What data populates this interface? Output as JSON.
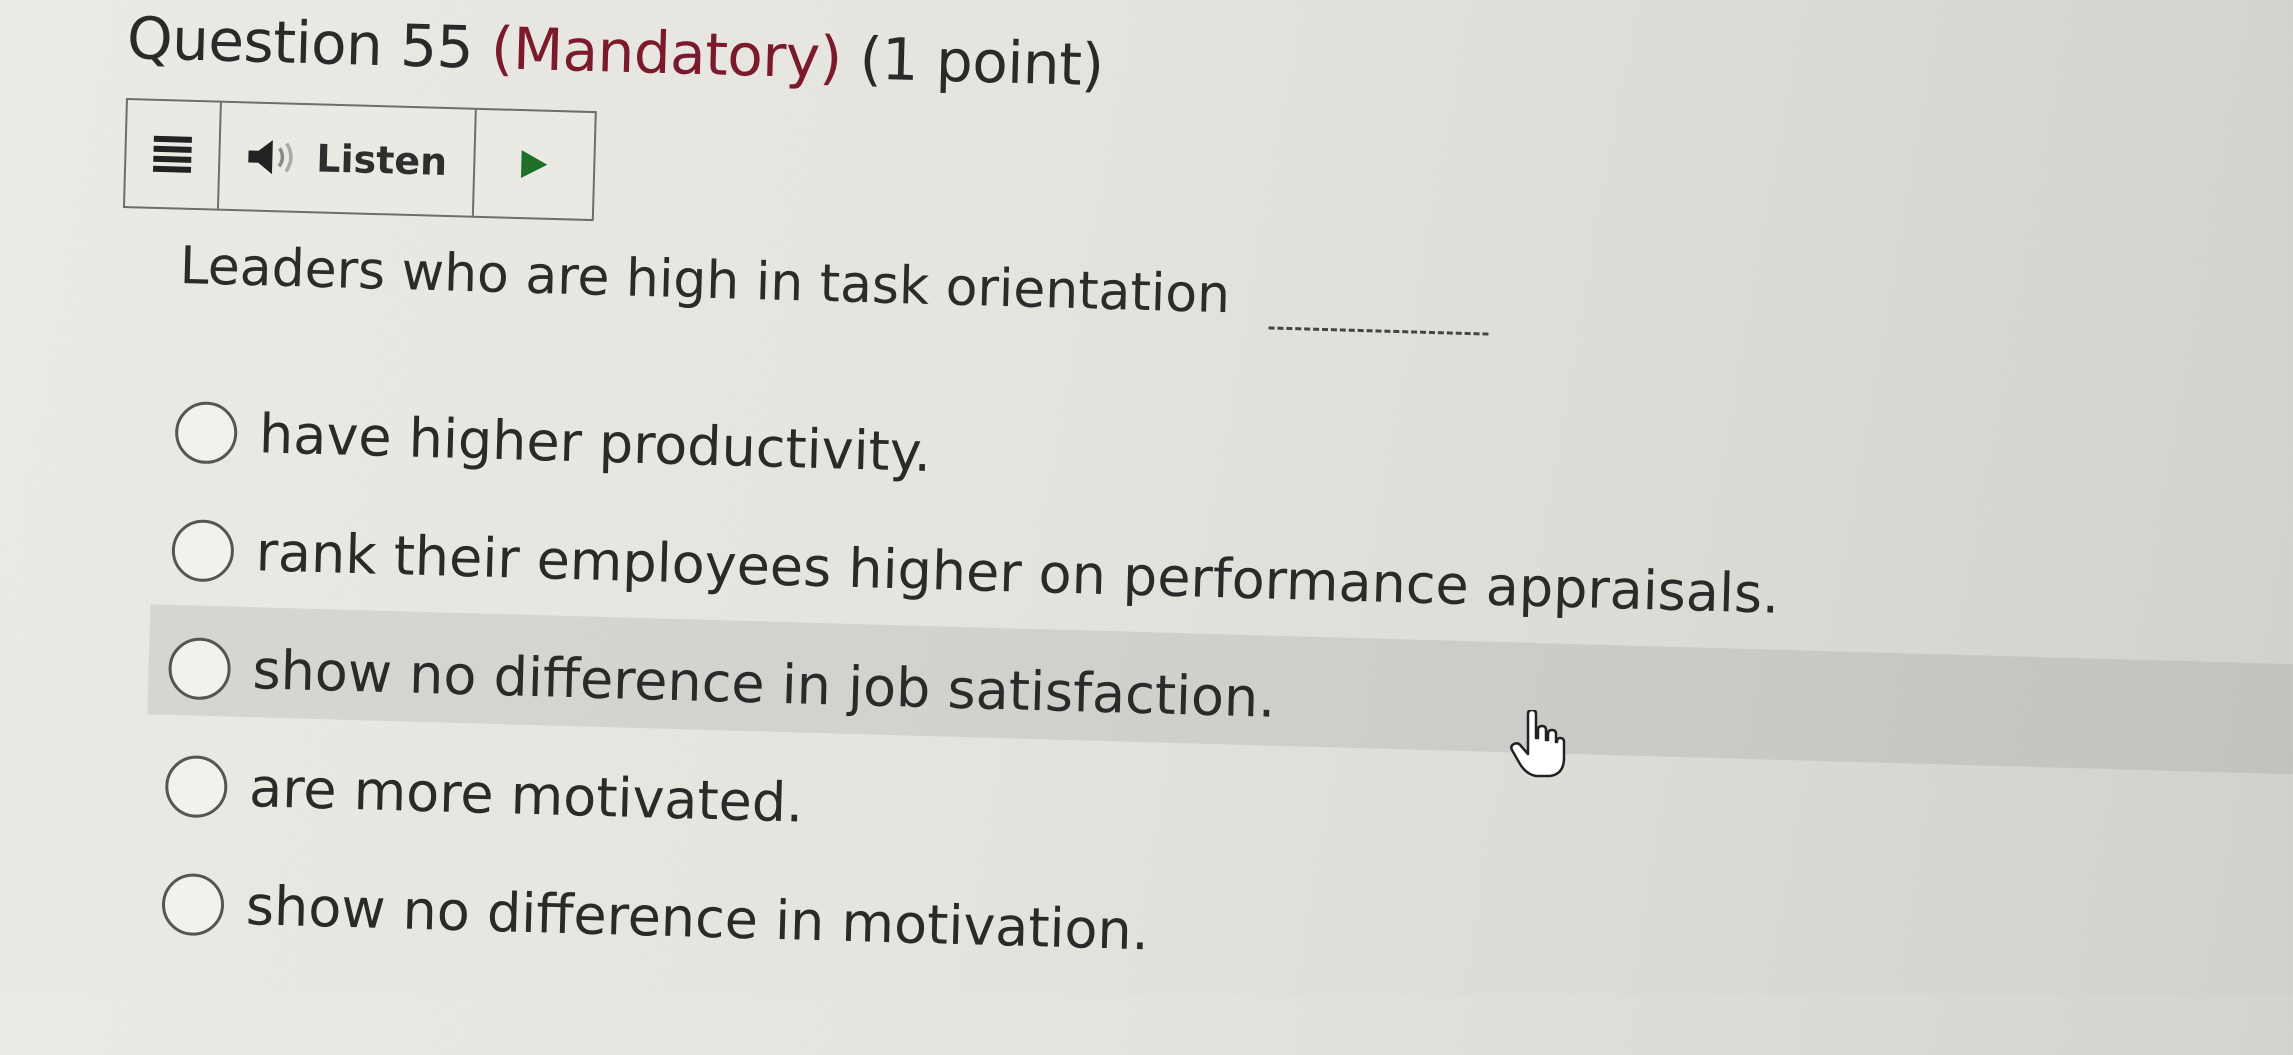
{
  "question": {
    "title_number": "Question 55",
    "title_mandatory": "(Mandatory)",
    "title_points": "(1 point)",
    "text": "Leaders who are high in task orientation",
    "blank": "________"
  },
  "toolbar": {
    "listen_label": "Listen",
    "menu_icon": "hamburger-icon",
    "speaker_icon": "speaker-icon",
    "play_icon": "play-icon",
    "play_color": "#1f6f2a"
  },
  "options": [
    {
      "label": "have higher productivity.",
      "selected": false
    },
    {
      "label": "rank their employees higher on performance appraisals.",
      "selected": false
    },
    {
      "label": "show no difference in job satisfaction.",
      "selected": false,
      "hovered": true
    },
    {
      "label": "are more motivated.",
      "selected": false
    },
    {
      "label": "show no difference in motivation.",
      "selected": false
    }
  ],
  "colors": {
    "mandatory": "#7a1a2a",
    "text": "#2a2a2a"
  },
  "cursor_icon": "hand-pointer-icon"
}
